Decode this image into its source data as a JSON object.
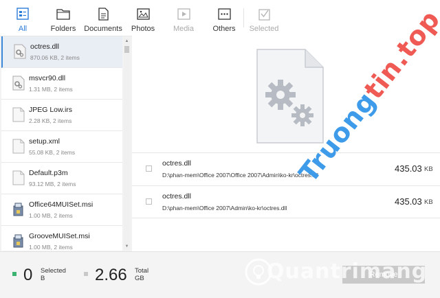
{
  "toolbar": {
    "items": [
      {
        "label": "All",
        "icon": "all-files-icon",
        "state": "active"
      },
      {
        "label": "Folders",
        "icon": "folder-icon",
        "state": "normal"
      },
      {
        "label": "Documents",
        "icon": "document-icon",
        "state": "normal"
      },
      {
        "label": "Photos",
        "icon": "photo-icon",
        "state": "normal"
      },
      {
        "label": "Media",
        "icon": "media-icon",
        "state": "disabled"
      },
      {
        "label": "Others",
        "icon": "others-icon",
        "state": "normal"
      },
      {
        "label": "Selected",
        "icon": "selected-icon",
        "state": "disabled"
      }
    ]
  },
  "file_list": [
    {
      "name": "octres.dll",
      "meta": "870.06 KB, 2 items",
      "icon": "dll-file-icon",
      "selected": true
    },
    {
      "name": "msvcr90.dll",
      "meta": "1.31 MB, 2 items",
      "icon": "dll-file-icon"
    },
    {
      "name": "JPEG Low.irs",
      "meta": "2.28 KB, 2 items",
      "icon": "blank-file-icon"
    },
    {
      "name": "setup.xml",
      "meta": "55.08 KB, 2 items",
      "icon": "blank-file-icon"
    },
    {
      "name": "Default.p3m",
      "meta": "93.12 MB, 2 items",
      "icon": "blank-file-icon"
    },
    {
      "name": "Office64MUISet.msi",
      "meta": "1.00 MB, 2 items",
      "icon": "installer-icon"
    },
    {
      "name": "GrooveMUISet.msi",
      "meta": "1.00 MB, 2 items",
      "icon": "installer-icon"
    }
  ],
  "details": [
    {
      "name": "octres.dll",
      "path": "D:\\phan-mem\\Office 2007\\Office 2007\\Admin\\ko-kr\\octres.dll",
      "size": "435.03",
      "unit": "KB"
    },
    {
      "name": "octres.dll",
      "path": "D:\\phan-mem\\Office 2007\\Admin\\ko-kr\\octres.dll",
      "size": "435.03",
      "unit": "KB"
    }
  ],
  "summary": {
    "selected_count": "0",
    "selected_label": "Selected",
    "selected_unit": "B",
    "total_value": "2.66",
    "total_label": "Total",
    "total_unit": "GB",
    "selected_dot_color": "#3cb371",
    "total_dot_color": "#c8c8c8"
  },
  "remove_button": {
    "label": "Remove"
  },
  "watermarks": {
    "diagonal_part1": "Truong",
    "diagonal_part2": "tin.top",
    "bottom": "Quantrimang",
    "bottom_icon": "lightbulb-logo-icon"
  },
  "colors": {
    "accent": "#2a7ad8",
    "watermark_blue": "#3d9be9",
    "watermark_red": "#f05a54",
    "remove_button_bg": "#c9c9c9"
  }
}
